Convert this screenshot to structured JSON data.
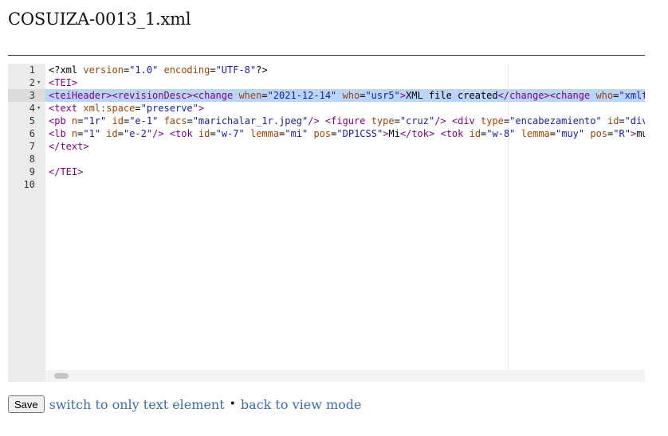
{
  "page": {
    "title": "COSUIZA-0013_1.xml"
  },
  "editor": {
    "line_numbers": [
      "1",
      "2",
      "3",
      "4",
      "5",
      "6",
      "7",
      "8",
      "9",
      "10"
    ],
    "fold_markers": [
      "",
      "▾",
      "",
      "▾",
      "",
      "",
      "",
      "",
      "",
      ""
    ],
    "active_line": 3,
    "lines": [
      [
        {
          "t": "pi",
          "v": "<?xml "
        },
        {
          "t": "attr",
          "v": "version"
        },
        {
          "t": "pi",
          "v": "="
        },
        {
          "t": "val",
          "v": "\"1.0\""
        },
        {
          "t": "pi",
          "v": " "
        },
        {
          "t": "attr",
          "v": "encoding"
        },
        {
          "t": "pi",
          "v": "="
        },
        {
          "t": "val",
          "v": "\"UTF-8\""
        },
        {
          "t": "pi",
          "v": "?>"
        }
      ],
      [
        {
          "t": "tag",
          "v": "<TEI>"
        }
      ],
      [
        {
          "t": "tag",
          "v": "<teiHeader>"
        },
        {
          "t": "tag",
          "v": "<revisionDesc>"
        },
        {
          "t": "tag",
          "v": "<change "
        },
        {
          "t": "attr",
          "v": "when"
        },
        {
          "t": "text",
          "v": "="
        },
        {
          "t": "val",
          "v": "\"2021-12-14\""
        },
        {
          "t": "text",
          "v": " "
        },
        {
          "t": "attr",
          "v": "who"
        },
        {
          "t": "text",
          "v": "="
        },
        {
          "t": "val",
          "v": "\"usr5\""
        },
        {
          "t": "tag",
          "v": ">"
        },
        {
          "t": "text",
          "v": "XML file created"
        },
        {
          "t": "tag",
          "v": "</change>"
        },
        {
          "t": "tag",
          "v": "<change "
        },
        {
          "t": "attr",
          "v": "who"
        },
        {
          "t": "text",
          "v": "="
        },
        {
          "t": "val",
          "v": "\"xmlt"
        }
      ],
      [
        {
          "t": "tag",
          "v": "<text "
        },
        {
          "t": "attr",
          "v": "xml:space"
        },
        {
          "t": "text",
          "v": "="
        },
        {
          "t": "val",
          "v": "\"preserve\""
        },
        {
          "t": "tag",
          "v": ">"
        }
      ],
      [
        {
          "t": "tag",
          "v": "<pb "
        },
        {
          "t": "attr",
          "v": "n"
        },
        {
          "t": "text",
          "v": "="
        },
        {
          "t": "val",
          "v": "\"1r\""
        },
        {
          "t": "text",
          "v": " "
        },
        {
          "t": "attr",
          "v": "id"
        },
        {
          "t": "text",
          "v": "="
        },
        {
          "t": "val",
          "v": "\"e-1\""
        },
        {
          "t": "text",
          "v": " "
        },
        {
          "t": "attr",
          "v": "facs"
        },
        {
          "t": "text",
          "v": "="
        },
        {
          "t": "val",
          "v": "\"marichalar_1r.jpeg\""
        },
        {
          "t": "tag",
          "v": "/>"
        },
        {
          "t": "text",
          "v": " "
        },
        {
          "t": "tag",
          "v": "<figure "
        },
        {
          "t": "attr",
          "v": "type"
        },
        {
          "t": "text",
          "v": "="
        },
        {
          "t": "val",
          "v": "\"cruz\""
        },
        {
          "t": "tag",
          "v": "/>"
        },
        {
          "t": "text",
          "v": " "
        },
        {
          "t": "tag",
          "v": "<div "
        },
        {
          "t": "attr",
          "v": "type"
        },
        {
          "t": "text",
          "v": "="
        },
        {
          "t": "val",
          "v": "\"encabezamiento\""
        },
        {
          "t": "text",
          "v": " "
        },
        {
          "t": "attr",
          "v": "id"
        },
        {
          "t": "text",
          "v": "="
        },
        {
          "t": "val",
          "v": "\"div"
        }
      ],
      [
        {
          "t": "tag",
          "v": "<lb "
        },
        {
          "t": "attr",
          "v": "n"
        },
        {
          "t": "text",
          "v": "="
        },
        {
          "t": "val",
          "v": "\"1\""
        },
        {
          "t": "text",
          "v": " "
        },
        {
          "t": "attr",
          "v": "id"
        },
        {
          "t": "text",
          "v": "="
        },
        {
          "t": "val",
          "v": "\"e-2\""
        },
        {
          "t": "tag",
          "v": "/>"
        },
        {
          "t": "text",
          "v": " "
        },
        {
          "t": "tag",
          "v": "<tok "
        },
        {
          "t": "attr",
          "v": "id"
        },
        {
          "t": "text",
          "v": "="
        },
        {
          "t": "val",
          "v": "\"w-7\""
        },
        {
          "t": "text",
          "v": " "
        },
        {
          "t": "attr",
          "v": "lemma"
        },
        {
          "t": "text",
          "v": "="
        },
        {
          "t": "val",
          "v": "\"mi\""
        },
        {
          "t": "text",
          "v": " "
        },
        {
          "t": "attr",
          "v": "pos"
        },
        {
          "t": "text",
          "v": "="
        },
        {
          "t": "val",
          "v": "\"DP1CSS\""
        },
        {
          "t": "tag",
          "v": ">"
        },
        {
          "t": "text",
          "v": "Mi"
        },
        {
          "t": "tag",
          "v": "</tok>"
        },
        {
          "t": "text",
          "v": " "
        },
        {
          "t": "tag",
          "v": "<tok "
        },
        {
          "t": "attr",
          "v": "id"
        },
        {
          "t": "text",
          "v": "="
        },
        {
          "t": "val",
          "v": "\"w-8\""
        },
        {
          "t": "text",
          "v": " "
        },
        {
          "t": "attr",
          "v": "lemma"
        },
        {
          "t": "text",
          "v": "="
        },
        {
          "t": "val",
          "v": "\"muy\""
        },
        {
          "t": "text",
          "v": " "
        },
        {
          "t": "attr",
          "v": "pos"
        },
        {
          "t": "text",
          "v": "="
        },
        {
          "t": "val",
          "v": "\"R\""
        },
        {
          "t": "tag",
          "v": ">"
        },
        {
          "t": "text",
          "v": "mu"
        }
      ],
      [
        {
          "t": "tag",
          "v": "</text>"
        }
      ],
      [],
      [
        {
          "t": "tag",
          "v": "</TEI>"
        }
      ],
      []
    ]
  },
  "footer": {
    "save_label": "Save",
    "switch_link": "switch to only text element",
    "separator": "•",
    "back_link": "back to view mode"
  }
}
